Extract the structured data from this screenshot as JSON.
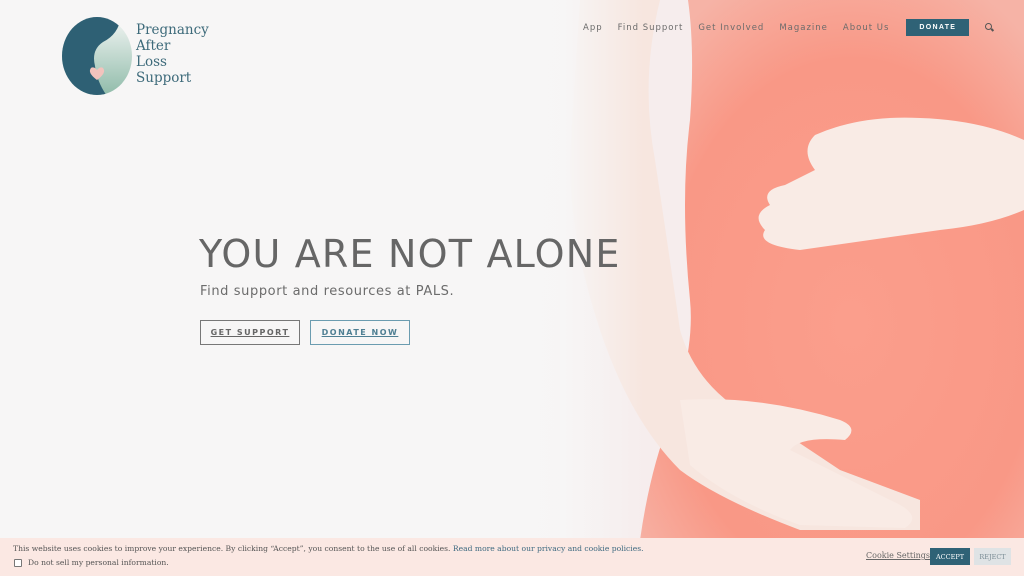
{
  "brand": {
    "name_lines": [
      "Pregnancy",
      "After",
      "Loss",
      "Support"
    ],
    "logo_icon": "heart-circle-logo",
    "colors": {
      "primary": "#2f6276",
      "accent_pink": "#f4c7c3",
      "mint": "#9cc4b4"
    }
  },
  "nav": {
    "items": [
      "App",
      "Find Support",
      "Get Involved",
      "Magazine",
      "About Us"
    ],
    "donate_label": "DONATE",
    "search_icon": "search-icon"
  },
  "hero": {
    "title": "YOU ARE NOT ALONE",
    "subtitle": "Find support and resources at PALS.",
    "primary_button": "GET SUPPORT",
    "secondary_button": "DONATE NOW",
    "image": "pregnant-woman-coral-top"
  },
  "cookie_banner": {
    "message": "This website uses cookies to improve your experience. By clicking “Accept”, you consent to the use of all cookies.",
    "link_text": "Read more about our privacy and cookie policies.",
    "opt_out_label": "Do not sell my personal information.",
    "opt_out_checked": false,
    "settings_label": "Cookie Settings",
    "accept_label": "ACCEPT",
    "reject_label": "REJECT"
  }
}
